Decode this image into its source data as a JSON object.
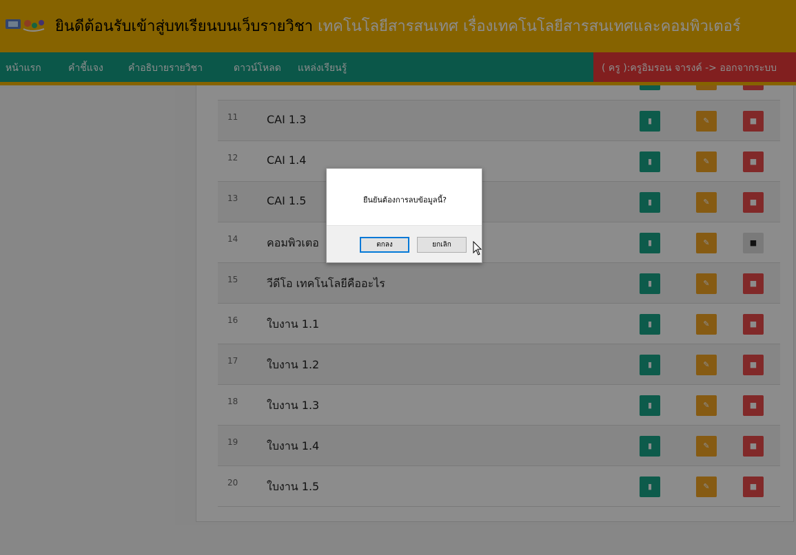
{
  "banner": {
    "title_part1": "ยินดีต้อนรับเข้าสู่บทเรียนบนเว็บรายวิชา",
    "title_part2": "เทคโนโลยีสารสนเทศ เรื่องเทคโนโลยีสารสนเทศและคอมพิวเตอร์"
  },
  "nav": {
    "items": [
      "หน้าแรก",
      "คำชี้แจง",
      "คำอธิบายรายวิชา",
      "ดาวน์โหลด",
      "แหล่งเรียนรู้"
    ],
    "user": "( ครู ):ครูอิมรอน จารงค์ -> ออกจากระบบ"
  },
  "rows": [
    {
      "num": "11",
      "title": "CAI 1.3"
    },
    {
      "num": "12",
      "title": "CAI 1.4"
    },
    {
      "num": "13",
      "title": "CAI 1.5"
    },
    {
      "num": "14",
      "title": "คอมพิวเตอ"
    },
    {
      "num": "15",
      "title": "วีดีโอ เทคโนโลยีคืออะไร"
    },
    {
      "num": "16",
      "title": "ใบงาน 1.1"
    },
    {
      "num": "17",
      "title": "ใบงาน 1.2"
    },
    {
      "num": "18",
      "title": "ใบงาน 1.3"
    },
    {
      "num": "19",
      "title": "ใบงาน 1.4"
    },
    {
      "num": "20",
      "title": "ใบงาน 1.5"
    }
  ],
  "dialog": {
    "message": "ยืนยันต้องการลบข้อมูลนี้?",
    "ok_label": "ตกลง",
    "cancel_label": "ยกเลิก"
  },
  "colors": {
    "banner": "#f4b400",
    "nav": "#149e86",
    "user": "#ec3a3a",
    "view_button": "#18a689",
    "edit_button": "#f5a623",
    "delete_button": "#ec4c4c"
  },
  "icons": {
    "view": "book-icon",
    "edit": "edit-icon",
    "delete": "trash-icon"
  }
}
